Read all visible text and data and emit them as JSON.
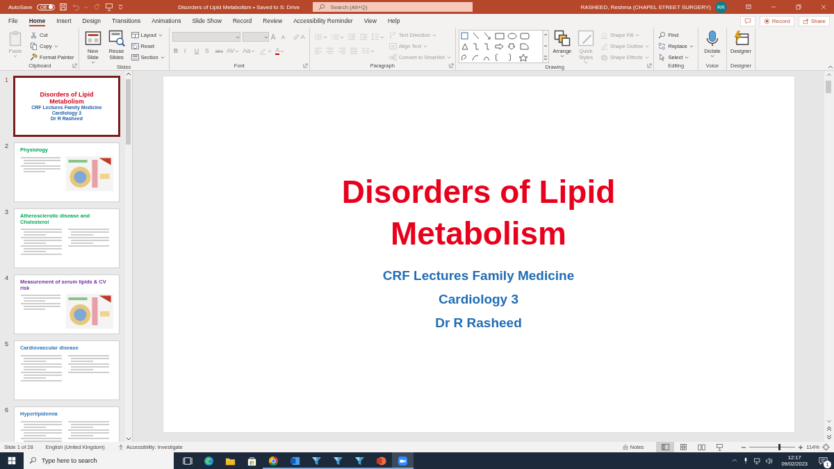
{
  "title_bar": {
    "autosave_label": "AutoSave",
    "autosave_toggle": {
      "label": "Off",
      "on": false
    },
    "title": "Disorders of Lipid Metabolism • Saved to S: Drive",
    "search": {
      "placeholder": "Search (Alt+Q)"
    },
    "user": "RASHEED, Reshma (CHAPEL STREET SURGERY)",
    "avatar": "RR"
  },
  "menu_tabs": [
    {
      "label": "File",
      "selected": false
    },
    {
      "label": "Home",
      "selected": true
    },
    {
      "label": "Insert",
      "selected": false
    },
    {
      "label": "Design",
      "selected": false
    },
    {
      "label": "Transitions",
      "selected": false
    },
    {
      "label": "Animations",
      "selected": false
    },
    {
      "label": "Slide Show",
      "selected": false
    },
    {
      "label": "Record",
      "selected": false
    },
    {
      "label": "Review",
      "selected": false
    },
    {
      "label": "Accessibility Reminder",
      "selected": false
    },
    {
      "label": "View",
      "selected": false
    },
    {
      "label": "Help",
      "selected": false
    }
  ],
  "ribbon_actions": [
    {
      "kind": "comments"
    },
    {
      "kind": "record",
      "label": "Record"
    },
    {
      "kind": "share",
      "label": "Share"
    }
  ],
  "ribbon_groups": [
    {
      "label": "Clipboard",
      "launcher": true,
      "sections": [
        {
          "kind": "large",
          "buttons": [
            {
              "kind": "paste",
              "label": "Paste",
              "dropdown": true,
              "disabled": true
            }
          ]
        },
        {
          "kind": "stack",
          "buttons": [
            {
              "kind": "cut",
              "label": "Cut",
              "dropdown": false,
              "disabled": false
            },
            {
              "kind": "copy",
              "label": "Copy",
              "dropdown": true,
              "disabled": false
            },
            {
              "kind": "format-painter",
              "label": "Format Painter",
              "dropdown": false,
              "disabled": false
            }
          ]
        }
      ]
    },
    {
      "label": "Slides",
      "launcher": false,
      "sections": [
        {
          "kind": "large",
          "buttons": [
            {
              "kind": "new-slide",
              "label": "New Slide",
              "dropdown": true,
              "disabled": false
            },
            {
              "kind": "reuse",
              "label": "Reuse Slides",
              "dropdown": false,
              "disabled": false
            }
          ]
        },
        {
          "kind": "stack",
          "buttons": [
            {
              "kind": "layout",
              "label": "Layout",
              "dropdown": true,
              "disabled": false
            },
            {
              "kind": "reset",
              "label": "Reset",
              "dropdown": false,
              "disabled": false
            },
            {
              "kind": "section",
              "label": "Section",
              "dropdown": true,
              "disabled": false
            }
          ]
        }
      ]
    },
    {
      "label": "Font",
      "launcher": true,
      "sections": [
        {
          "kind": "rows",
          "rows": [
            [
              {
                "kind": "font-field",
                "dropdown": true,
                "disabled": true
              },
              {
                "kind": "size-field",
                "dropdown": true,
                "disabled": true
              },
              {
                "kind": "grow",
                "label": "A",
                "dropdown": false,
                "disabled": true
              },
              {
                "kind": "shrink",
                "label": "A",
                "dropdown": false,
                "disabled": true
              },
              {
                "kind": "clear",
                "label": "A",
                "dropdown": false,
                "disabled": true
              }
            ],
            [
              {
                "kind": "bold",
                "label": "B",
                "dropdown": false,
                "disabled": true
              },
              {
                "kind": "italic",
                "label": "I",
                "dropdown": false,
                "disabled": true
              },
              {
                "kind": "underline",
                "label": "U",
                "dropdown": false,
                "disabled": true
              },
              {
                "kind": "shadow",
                "label": "S",
                "dropdown": false,
                "disabled": true
              },
              {
                "kind": "strike",
                "label": "abc",
                "dropdown": false,
                "disabled": true
              },
              {
                "kind": "spacing",
                "label": "AV",
                "dropdown": true,
                "disabled": true
              },
              {
                "kind": "case",
                "label": "Aa",
                "dropdown": true,
                "disabled": true
              },
              {
                "kind": "highlight",
                "dropdown": true,
                "disabled": true
              },
              {
                "kind": "font-color",
                "label": "A",
                "dropdown": true,
                "disabled": true
              }
            ]
          ]
        }
      ]
    },
    {
      "label": "Paragraph",
      "launcher": true,
      "sections": [
        {
          "kind": "rows",
          "rows": [
            [
              {
                "kind": "bullets",
                "dropdown": true,
                "disabled": true
              },
              {
                "kind": "numbering",
                "dropdown": true,
                "disabled": true
              },
              {
                "kind": "dec-indent",
                "dropdown": false,
                "disabled": true
              },
              {
                "kind": "inc-indent",
                "dropdown": false,
                "disabled": true
              },
              {
                "kind": "line-spacing",
                "dropdown": true,
                "disabled": true
              }
            ],
            [
              {
                "kind": "align-left",
                "dropdown": false,
                "disabled": true
              },
              {
                "kind": "align-center",
                "dropdown": false,
                "disabled": true
              },
              {
                "kind": "align-right",
                "dropdown": false,
                "disabled": true
              },
              {
                "kind": "justify",
                "dropdown": false,
                "disabled": true
              },
              {
                "kind": "columns",
                "dropdown": true,
                "disabled": true
              }
            ]
          ]
        },
        {
          "kind": "stack",
          "buttons": [
            {
              "kind": "text-direction",
              "label": "Text Direction",
              "dropdown": true,
              "disabled": true
            },
            {
              "kind": "align-text",
              "label": "Align Text",
              "dropdown": true,
              "disabled": true
            },
            {
              "kind": "smartart",
              "label": "Convert to SmartArt",
              "dropdown": true,
              "disabled": true
            }
          ]
        }
      ]
    },
    {
      "label": "Drawing",
      "launcher": true,
      "sections": [
        {
          "kind": "gallery"
        },
        {
          "kind": "large",
          "buttons": [
            {
              "kind": "arrange",
              "label": "Arrange",
              "dropdown": true,
              "disabled": false
            },
            {
              "kind": "quick-styles",
              "label": "Quick Styles",
              "dropdown": true,
              "disabled": true
            }
          ]
        },
        {
          "kind": "stack",
          "buttons": [
            {
              "kind": "shape-fill",
              "label": "Shape Fill",
              "dropdown": true,
              "disabled": true
            },
            {
              "kind": "shape-outline",
              "label": "Shape Outline",
              "dropdown": true,
              "disabled": true
            },
            {
              "kind": "shape-effects",
              "label": "Shape Effects",
              "dropdown": true,
              "disabled": true
            }
          ]
        }
      ]
    },
    {
      "label": "Editing",
      "launcher": false,
      "sections": [
        {
          "kind": "stack",
          "buttons": [
            {
              "kind": "find",
              "label": "Find",
              "dropdown": false,
              "disabled": false
            },
            {
              "kind": "replace",
              "label": "Replace",
              "dropdown": true,
              "disabled": false
            },
            {
              "kind": "select",
              "label": "Select",
              "dropdown": true,
              "disabled": false
            }
          ]
        }
      ]
    },
    {
      "label": "Voice",
      "launcher": false,
      "sections": [
        {
          "kind": "large",
          "buttons": [
            {
              "kind": "dictate",
              "label": "Dictate",
              "dropdown": true,
              "disabled": false
            }
          ]
        }
      ]
    },
    {
      "label": "Designer",
      "launcher": false,
      "sections": [
        {
          "kind": "large",
          "buttons": [
            {
              "kind": "designer",
              "label": "Designer",
              "dropdown": false,
              "disabled": false
            }
          ]
        }
      ]
    }
  ],
  "slides": [
    {
      "number": "1",
      "selected": true,
      "kind": "title",
      "title": "Disorders of Lipid Metabolism",
      "color": "#d0021b",
      "subtitles": [
        "CRF Lectures Family Medicine",
        "Cardiology 3",
        "Dr R Rasheed"
      ]
    },
    {
      "number": "2",
      "selected": false,
      "kind": "picture",
      "title": "Physiology",
      "color": "#00a651"
    },
    {
      "number": "3",
      "selected": false,
      "kind": "columns",
      "title": "Atherosclerotic disease and Cholesterol",
      "color": "#00a651"
    },
    {
      "number": "4",
      "selected": false,
      "kind": "picture",
      "title": "Measurement of serum lipids & CV risk",
      "color": "#7030a0"
    },
    {
      "number": "5",
      "selected": false,
      "kind": "columns",
      "title": "Cardiovascular disease",
      "color": "#2e75b6"
    },
    {
      "number": "6",
      "selected": false,
      "kind": "columns",
      "title": "Hyperlipidemia",
      "color": "#2e75b6"
    }
  ],
  "slide": {
    "title": "Disorders of Lipid Metabolism",
    "subtitles": [
      "CRF Lectures Family Medicine",
      "Cardiology 3",
      "Dr R Rasheed"
    ]
  },
  "status_bar": {
    "slide_count": "Slide 1 of 28",
    "language": "English (United Kingdom)",
    "accessibility": "Accessibility: Investigate",
    "notes": "Notes",
    "views": [
      {
        "kind": "normal",
        "selected": true
      },
      {
        "kind": "sorter",
        "selected": false
      },
      {
        "kind": "reading",
        "selected": false
      },
      {
        "kind": "slideshow",
        "selected": false
      }
    ],
    "zoom": {
      "level": 0.64,
      "reading": "114%"
    }
  },
  "taskbar": {
    "search": {
      "placeholder": "Type here to search"
    },
    "apps": [
      {
        "kind": "task-view",
        "running": false,
        "selected": false
      },
      {
        "kind": "edge",
        "running": false,
        "selected": false
      },
      {
        "kind": "explorer",
        "running": false,
        "selected": false
      },
      {
        "kind": "store",
        "running": false,
        "selected": false
      },
      {
        "kind": "chrome",
        "running": true,
        "selected": false
      },
      {
        "kind": "word",
        "running": true,
        "selected": false
      },
      {
        "kind": "funnel",
        "running": true,
        "selected": false
      },
      {
        "kind": "funnel",
        "running": true,
        "selected": false
      },
      {
        "kind": "funnel",
        "running": true,
        "selected": false
      },
      {
        "kind": "powerpoint",
        "running": true,
        "selected": false
      },
      {
        "kind": "zoom",
        "running": true,
        "selected": true
      }
    ],
    "time": "12:17",
    "date": "09/02/2023",
    "notifications": "1"
  }
}
